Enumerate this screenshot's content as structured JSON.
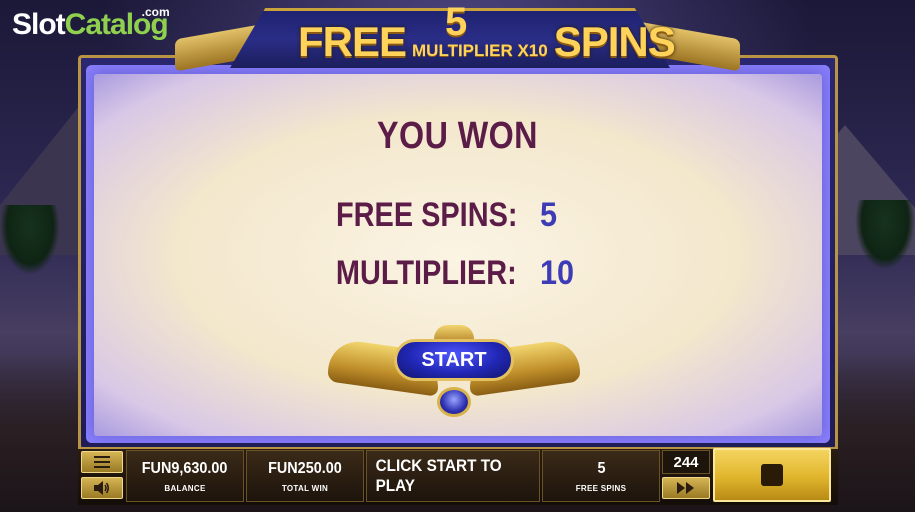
{
  "watermark": {
    "part1": "Slot",
    "part2": "Catalog",
    "suffix": ".com"
  },
  "banner": {
    "count": "5",
    "free": "FREE",
    "multiplier": "MULTIPLIER X10",
    "spins": "SPINS"
  },
  "popup": {
    "heading": "YOU WON",
    "rows": [
      {
        "label": "FREE SPINS:",
        "value": "5"
      },
      {
        "label": "MULTIPLIER:",
        "value": "10"
      }
    ],
    "start_label": "START"
  },
  "bottom_bar": {
    "menu_icon": "hamburger-icon",
    "sound_icon": "speaker-icon",
    "balance_value": "FUN9,630.00",
    "balance_label": "BALANCE",
    "total_win_value": "FUN250.00",
    "total_win_label": "TOTAL WIN",
    "message": "CLICK START TO PLAY",
    "free_spins_value": "5",
    "free_spins_label": "FREE SPINS",
    "ways": "244",
    "fast_forward_icon": "fast-forward-icon",
    "spin_icon": "stop-icon"
  },
  "colors": {
    "heading": "#5c1c48",
    "value": "#3d3cb6",
    "gold": "#d4b453",
    "start_button": "#2127b5",
    "logo_green": "#8fd14f"
  }
}
